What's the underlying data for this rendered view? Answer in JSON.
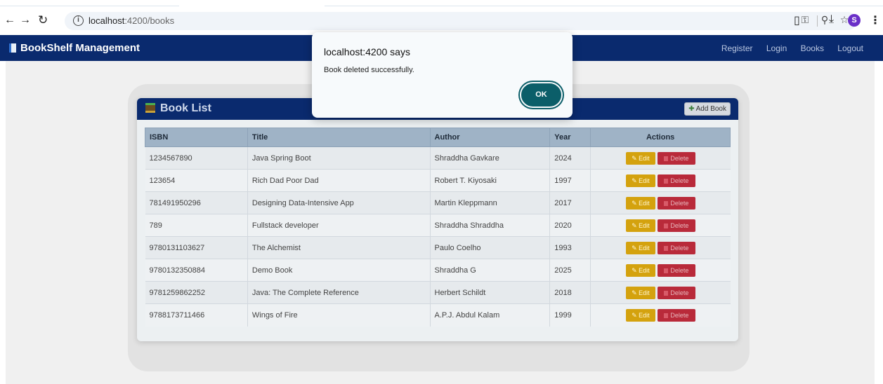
{
  "browser": {
    "url_host": "localhost",
    "url_rest": ":4200/books",
    "avatar_letter": "S"
  },
  "navbar": {
    "brand": "BookShelf Management",
    "links": [
      "Register",
      "Login",
      "Books",
      "Logout"
    ]
  },
  "card": {
    "title": "Book List",
    "add_button": "Add Book"
  },
  "table": {
    "headers": [
      "ISBN",
      "Title",
      "Author",
      "Year",
      "Actions"
    ],
    "edit_label": "Edit",
    "delete_label": "Delete",
    "rows": [
      {
        "isbn": "1234567890",
        "title": "Java Spring Boot",
        "author": "Shraddha Gavkare",
        "year": "2024"
      },
      {
        "isbn": "123654",
        "title": "Rich Dad Poor Dad",
        "author": "Robert T. Kiyosaki",
        "year": "1997"
      },
      {
        "isbn": "781491950296",
        "title": "Designing Data-Intensive App",
        "author": "Martin Kleppmann",
        "year": "2017"
      },
      {
        "isbn": "789",
        "title": "Fullstack developer",
        "author": "Shraddha Shraddha",
        "year": "2020"
      },
      {
        "isbn": "9780131103627",
        "title": "The Alchemist",
        "author": "Paulo Coelho",
        "year": "1993"
      },
      {
        "isbn": "9780132350884",
        "title": "Demo Book",
        "author": "Shraddha G",
        "year": "2025"
      },
      {
        "isbn": "9781259862252",
        "title": "Java: The Complete Reference",
        "author": "Herbert Schildt",
        "year": "2018"
      },
      {
        "isbn": "9788173711466",
        "title": "Wings of Fire",
        "author": "A.P.J. Abdul Kalam",
        "year": "1999"
      }
    ]
  },
  "dialog": {
    "title": "localhost:4200 says",
    "message": "Book deleted successfully.",
    "ok": "OK"
  },
  "colors": {
    "navbar": "#0a2a6e",
    "edit": "#d4a20e",
    "delete": "#b92a3a",
    "ok_button": "#0b5e69"
  }
}
